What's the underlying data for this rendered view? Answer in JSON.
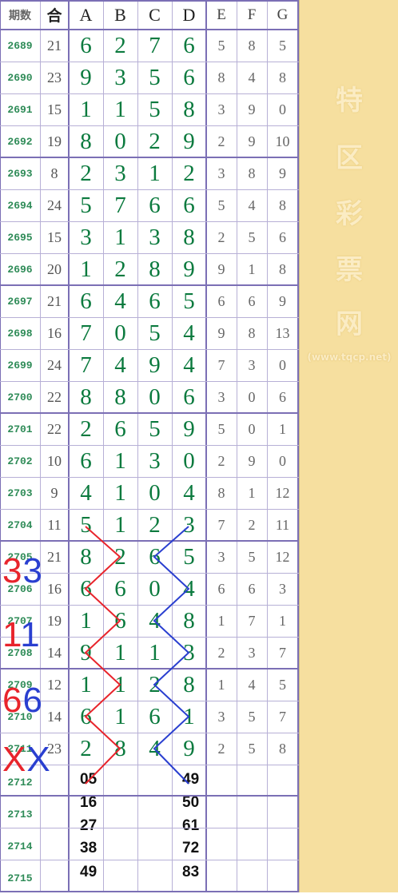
{
  "header": {
    "period": "期数",
    "sum": "合",
    "big_cols": [
      "A",
      "B",
      "C",
      "D"
    ],
    "small_cols": [
      "E",
      "F",
      "G"
    ]
  },
  "rows": [
    {
      "id": "2689",
      "sum": "21",
      "big": [
        "6",
        "2",
        "7",
        "6"
      ],
      "small": [
        "5",
        "8",
        "5"
      ]
    },
    {
      "id": "2690",
      "sum": "23",
      "big": [
        "9",
        "3",
        "5",
        "6"
      ],
      "small": [
        "8",
        "4",
        "8"
      ]
    },
    {
      "id": "2691",
      "sum": "15",
      "big": [
        "1",
        "1",
        "5",
        "8"
      ],
      "small": [
        "3",
        "9",
        "0"
      ]
    },
    {
      "id": "2692",
      "sum": "19",
      "big": [
        "8",
        "0",
        "2",
        "9"
      ],
      "small": [
        "2",
        "9",
        "10"
      ]
    },
    {
      "id": "2693",
      "sum": "8",
      "big": [
        "2",
        "3",
        "1",
        "2"
      ],
      "small": [
        "3",
        "8",
        "9"
      ]
    },
    {
      "id": "2694",
      "sum": "24",
      "big": [
        "5",
        "7",
        "6",
        "6"
      ],
      "small": [
        "5",
        "4",
        "8"
      ]
    },
    {
      "id": "2695",
      "sum": "15",
      "big": [
        "3",
        "1",
        "3",
        "8"
      ],
      "small": [
        "2",
        "5",
        "6"
      ]
    },
    {
      "id": "2696",
      "sum": "20",
      "big": [
        "1",
        "2",
        "8",
        "9"
      ],
      "small": [
        "9",
        "1",
        "8"
      ]
    },
    {
      "id": "2697",
      "sum": "21",
      "big": [
        "6",
        "4",
        "6",
        "5"
      ],
      "small": [
        "6",
        "6",
        "9"
      ]
    },
    {
      "id": "2698",
      "sum": "16",
      "big": [
        "7",
        "0",
        "5",
        "4"
      ],
      "small": [
        "9",
        "8",
        "13"
      ]
    },
    {
      "id": "2699",
      "sum": "24",
      "big": [
        "7",
        "4",
        "9",
        "4"
      ],
      "small": [
        "7",
        "3",
        "0"
      ]
    },
    {
      "id": "2700",
      "sum": "22",
      "big": [
        "8",
        "8",
        "0",
        "6"
      ],
      "small": [
        "3",
        "0",
        "6"
      ]
    },
    {
      "id": "2701",
      "sum": "22",
      "big": [
        "2",
        "6",
        "5",
        "9"
      ],
      "small": [
        "5",
        "0",
        "1"
      ]
    },
    {
      "id": "2702",
      "sum": "10",
      "big": [
        "6",
        "1",
        "3",
        "0"
      ],
      "small": [
        "2",
        "9",
        "0"
      ]
    },
    {
      "id": "2703",
      "sum": "9",
      "big": [
        "4",
        "1",
        "0",
        "4"
      ],
      "small": [
        "8",
        "1",
        "12"
      ]
    },
    {
      "id": "2704",
      "sum": "11",
      "big": [
        "5",
        "1",
        "2",
        "3"
      ],
      "small": [
        "7",
        "2",
        "11"
      ]
    },
    {
      "id": "2705",
      "sum": "21",
      "big": [
        "8",
        "2",
        "6",
        "5"
      ],
      "small": [
        "3",
        "5",
        "12"
      ]
    },
    {
      "id": "2706",
      "sum": "16",
      "big": [
        "6",
        "6",
        "0",
        "4"
      ],
      "small": [
        "6",
        "6",
        "3"
      ]
    },
    {
      "id": "2707",
      "sum": "19",
      "big": [
        "1",
        "6",
        "4",
        "8"
      ],
      "small": [
        "1",
        "7",
        "1"
      ]
    },
    {
      "id": "2708",
      "sum": "14",
      "big": [
        "9",
        "1",
        "1",
        "3"
      ],
      "small": [
        "2",
        "3",
        "7"
      ]
    },
    {
      "id": "2709",
      "sum": "12",
      "big": [
        "1",
        "1",
        "2",
        "8"
      ],
      "small": [
        "1",
        "4",
        "5"
      ]
    },
    {
      "id": "2710",
      "sum": "14",
      "big": [
        "6",
        "1",
        "6",
        "1"
      ],
      "small": [
        "3",
        "5",
        "7"
      ]
    },
    {
      "id": "2711",
      "sum": "23",
      "big": [
        "2",
        "8",
        "4",
        "9"
      ],
      "small": [
        "2",
        "5",
        "8"
      ]
    }
  ],
  "future_ids": [
    "2712",
    "2713",
    "2714",
    "2715"
  ],
  "pred_left": [
    "05",
    "16",
    "27",
    "38",
    "49"
  ],
  "pred_right": [
    "49",
    "50",
    "61",
    "72",
    "83"
  ],
  "legend": {
    "red1": "33",
    "blue1": "11",
    "red2": "66",
    "blue2": "XX"
  },
  "side": {
    "chars": [
      "特",
      "区",
      "彩",
      "票",
      "网"
    ],
    "url": "(www.tqcp.net)"
  },
  "colors": {
    "big_digit": "#0b7a3e",
    "period_id": "#2e8b57",
    "red_line": "#e8242c",
    "blue_line": "#2a3fd0",
    "sidebar": "#f6df9f"
  }
}
